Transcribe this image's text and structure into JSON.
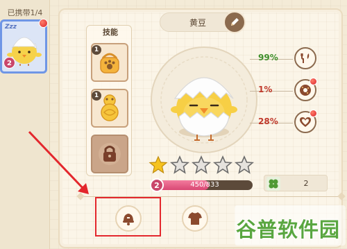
{
  "carry": {
    "header": "已携带1/4",
    "slot_zzz": "Zzz",
    "slot_level": "2"
  },
  "skills": {
    "title": "技能",
    "cards": [
      {
        "badge": "1",
        "icon": "paw-bag-icon"
      },
      {
        "badge": "1",
        "icon": "gourd-icon"
      },
      {
        "icon": "lock-icon"
      }
    ]
  },
  "pet": {
    "name": "黄豆",
    "level": "2",
    "exp_text": "450/833",
    "exp_fraction": 0.54,
    "stars_filled": 1,
    "stars_total": 5
  },
  "stats": [
    {
      "value": "99%",
      "color": "#3f8f2b",
      "icon": "fork-knife-icon",
      "dot": false
    },
    {
      "value": "1%",
      "color": "#c0392b",
      "icon": "donut-icon",
      "dot": true
    },
    {
      "value": "28%",
      "color": "#c0392b",
      "icon": "heart-icon",
      "dot": true
    }
  ],
  "clover": {
    "count": "2"
  },
  "bottom_buttons": [
    "bell-icon",
    "shirt-icon"
  ],
  "watermark": {
    "text": "谷普软件园"
  },
  "colors": {
    "annotation_red": "#e3272d",
    "accent_blue": "#6f96e6"
  }
}
